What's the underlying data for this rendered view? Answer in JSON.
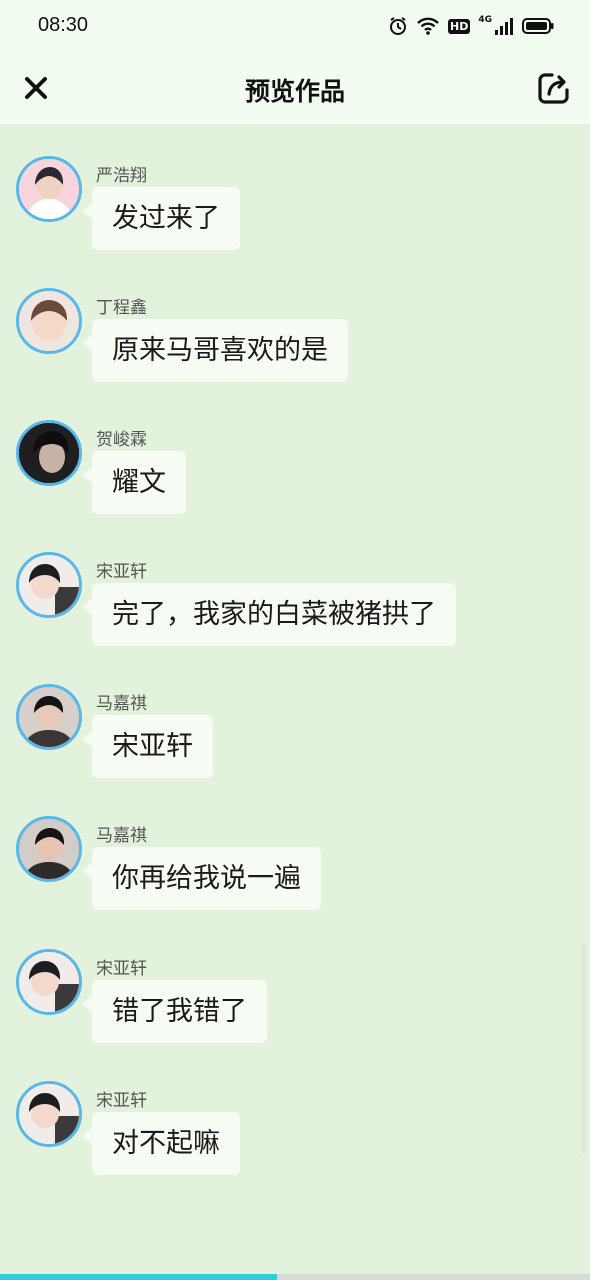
{
  "status_bar": {
    "time": "08:30",
    "hd_label": "HD",
    "network_label": "4G",
    "icons": [
      "alarm-icon",
      "wifi-icon",
      "hd-icon",
      "signal-icon",
      "battery-icon"
    ]
  },
  "header": {
    "title": "预览作品",
    "close_icon": "close-icon",
    "share_icon": "share-icon"
  },
  "messages": [
    {
      "name": "严浩翔",
      "text": "发过来了"
    },
    {
      "name": "丁程鑫",
      "text": "原来马哥喜欢的是"
    },
    {
      "name": "贺峻霖",
      "text": "耀文"
    },
    {
      "name": "宋亚轩",
      "text": "完了，我家的白菜被猪拱了"
    },
    {
      "name": "马嘉祺",
      "text": "宋亚轩"
    },
    {
      "name": "马嘉祺",
      "text": "你再给我说一遍"
    },
    {
      "name": "宋亚轩",
      "text": "错了我错了"
    },
    {
      "name": "宋亚轩",
      "text": "对不起嘛"
    }
  ],
  "progress": 0.47,
  "colors": {
    "background": "#e3f2dd",
    "header": "#f3fcf1",
    "bubble": "#f6fbf3",
    "avatar_ring": "#58b7ea",
    "progress": "#35cdd4"
  }
}
